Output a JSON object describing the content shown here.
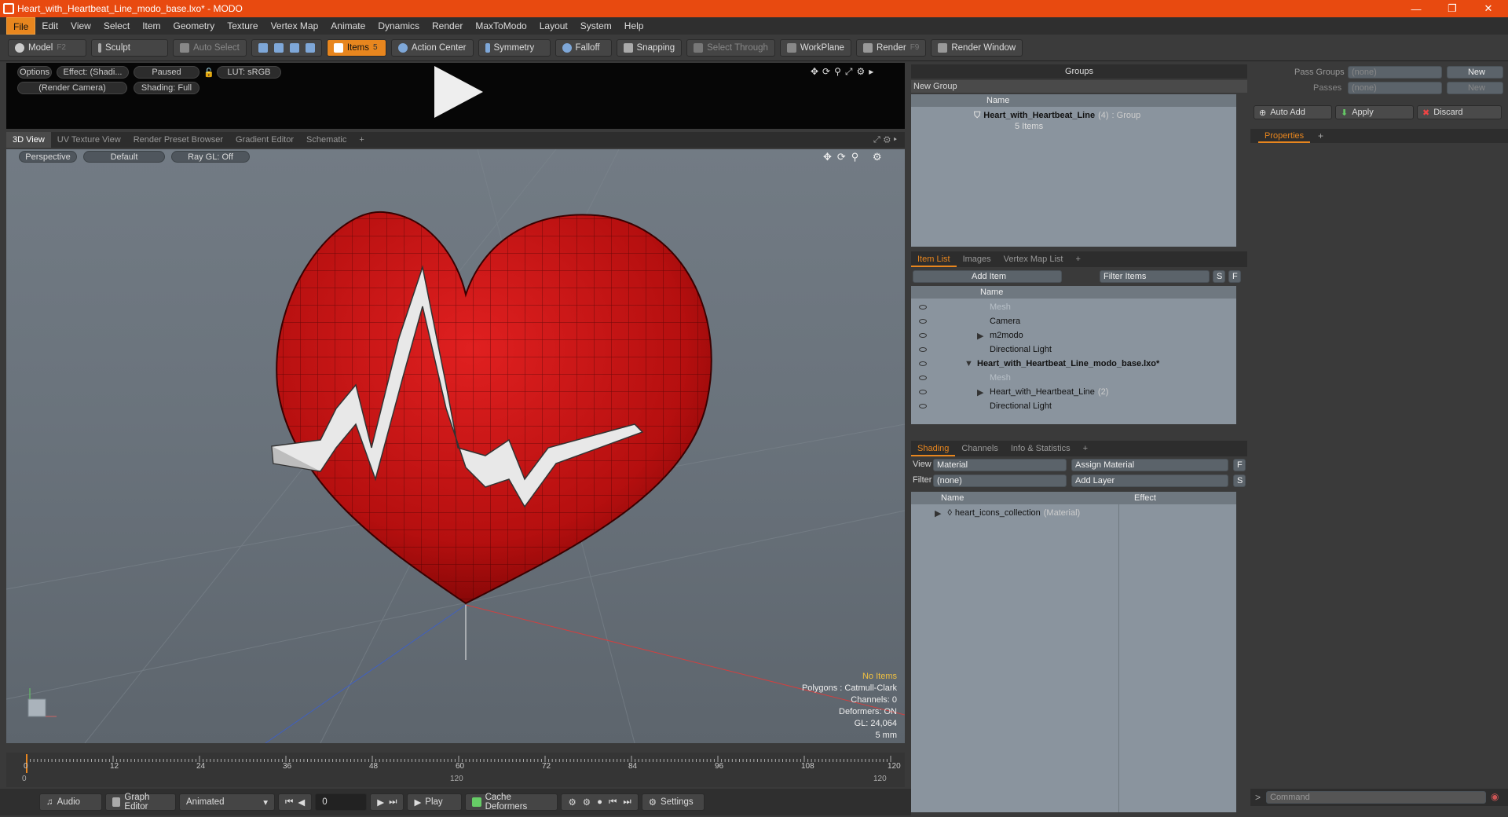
{
  "window": {
    "title": "Heart_with_Heartbeat_Line_modo_base.lxo* - MODO",
    "minimize": "—",
    "restore": "❐",
    "close": "✕"
  },
  "menu": [
    "File",
    "Edit",
    "View",
    "Select",
    "Item",
    "Geometry",
    "Texture",
    "Vertex Map",
    "Animate",
    "Dynamics",
    "Render",
    "MaxToModo",
    "Layout",
    "System",
    "Help"
  ],
  "toolbar": {
    "model": "Model",
    "model_key": "F2",
    "sculpt": "Sculpt",
    "auto_select": "Auto Select",
    "items": "Items",
    "items_key": "5",
    "action_center": "Action Center",
    "symmetry": "Symmetry",
    "falloff": "Falloff",
    "snapping": "Snapping",
    "select_through": "Select Through",
    "workplane": "WorkPlane",
    "render": "Render",
    "render_key": "F9",
    "render_window": "Render Window"
  },
  "preview": {
    "options": "Options",
    "effect": "Effect: (Shadi...",
    "paused": "Paused",
    "lut": "LUT: sRGB",
    "camera": "(Render Camera)",
    "shading": "Shading: Full"
  },
  "viewport_tabs": [
    "3D View",
    "UV Texture View",
    "Render Preset Browser",
    "Gradient Editor",
    "Schematic",
    "+"
  ],
  "viewport": {
    "perspective": "Perspective",
    "default": "Default",
    "raygl": "Ray GL: Off",
    "stats": {
      "no_items": "No Items",
      "polygons": "Polygons : Catmull-Clark",
      "channels": "Channels: 0",
      "deformers": "Deformers: ON",
      "gl": "GL: 24,064",
      "unit": "5 mm"
    }
  },
  "timeline": {
    "ticks": [
      "0",
      "12",
      "24",
      "36",
      "48",
      "60",
      "72",
      "84",
      "96",
      "108",
      "120"
    ],
    "bottom": [
      "0",
      "120",
      "120"
    ]
  },
  "transport": {
    "audio": "Audio",
    "graph_editor": "Graph Editor",
    "animated": "Animated",
    "frame": "0",
    "play": "Play",
    "cache": "Cache Deformers",
    "settings": "Settings"
  },
  "groups": {
    "title": "Groups",
    "new_group": "New Group",
    "col_name": "Name",
    "row_name": "Heart_with_Heartbeat_Line",
    "row_count": "(4)",
    "row_type": ": Group",
    "row_sub": "5 Items"
  },
  "itemlist": {
    "tabs": [
      "Item List",
      "Images",
      "Vertex Map List",
      "+"
    ],
    "add_item": "Add Item",
    "filter": "Filter Items",
    "s": "S",
    "f": "F",
    "col_name": "Name",
    "rows": [
      {
        "label": "Mesh",
        "dim": true,
        "indent": 1
      },
      {
        "label": "Camera",
        "dim": false,
        "indent": 1
      },
      {
        "label": "m2modo",
        "dim": false,
        "indent": 1,
        "arrow": "▶"
      },
      {
        "label": "Directional Light",
        "dim": false,
        "indent": 1
      },
      {
        "label": "Heart_with_Heartbeat_Line_modo_base.lxo*",
        "dim": false,
        "indent": 0,
        "arrow": "▼",
        "bold": true
      },
      {
        "label": "Mesh",
        "dim": true,
        "indent": 1
      },
      {
        "label": "Heart_with_Heartbeat_Line",
        "suffix": "(2)",
        "dim": false,
        "indent": 1,
        "arrow": "▶"
      },
      {
        "label": "Directional Light",
        "dim": false,
        "indent": 1
      }
    ]
  },
  "shading": {
    "tabs": [
      "Shading",
      "Channels",
      "Info & Statistics",
      "+"
    ],
    "view_label": "View",
    "view_value": "Material",
    "assign": "Assign Material",
    "f": "F",
    "filter_label": "Filter",
    "filter_value": "(none)",
    "add_layer": "Add Layer",
    "s": "S",
    "col_name": "Name",
    "col_effect": "Effect",
    "row_name": "heart_icons_collection",
    "row_type": "(Material)"
  },
  "right": {
    "pass_groups": "Pass Groups",
    "passes": "Passes",
    "none": "(none)",
    "new": "New",
    "auto_add": "Auto Add",
    "apply": "Apply",
    "discard": "Discard",
    "properties": "Properties",
    "plus": "+",
    "command": "Command",
    "prompt": ">"
  }
}
